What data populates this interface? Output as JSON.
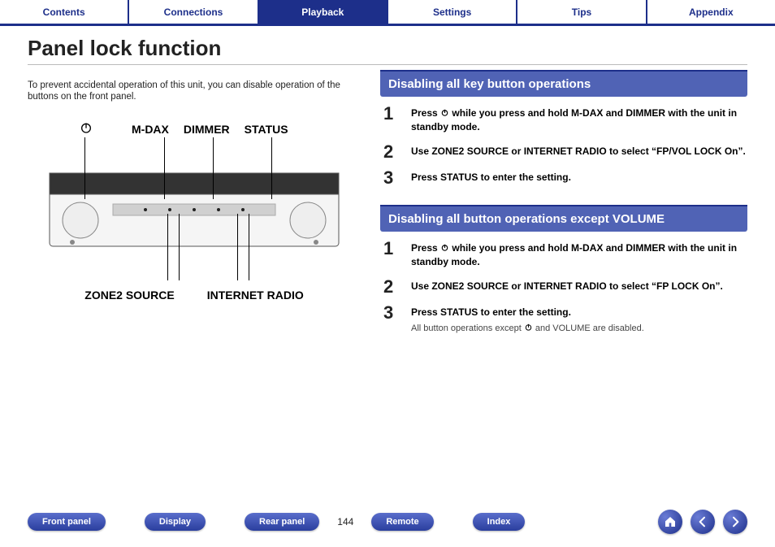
{
  "top_tabs": {
    "contents": "Contents",
    "connections": "Connections",
    "playback": "Playback",
    "settings": "Settings",
    "tips": "Tips",
    "appendix": "Appendix"
  },
  "active_tab": "playback",
  "page_title": "Panel lock function",
  "intro": "To prevent accidental operation of this unit, you can disable operation of the buttons on the front panel.",
  "diagram": {
    "labels_top": {
      "mdax": "M-DAX",
      "dimmer": "DIMMER",
      "status": "STATUS"
    },
    "labels_bottom": {
      "zone2_source": "ZONE2 SOURCE",
      "internet_radio": "INTERNET RADIO"
    }
  },
  "sections": [
    {
      "title": "Disabling all key button operations",
      "steps": [
        {
          "text_before": "Press ",
          "has_power_icon": true,
          "text_after": " while you press and hold M-DAX and DIMMER with the unit in standby mode."
        },
        {
          "text": "Use ZONE2 SOURCE or INTERNET RADIO to select “FP/VOL LOCK On”."
        },
        {
          "text": "Press STATUS to enter the setting."
        }
      ]
    },
    {
      "title": "Disabling all button operations except VOLUME",
      "steps": [
        {
          "text_before": "Press ",
          "has_power_icon": true,
          "text_after": " while you press and hold M-DAX and DIMMER with the unit in standby mode."
        },
        {
          "text": "Use ZONE2 SOURCE or INTERNET RADIO to select “FP LOCK On”."
        },
        {
          "text": "Press STATUS to enter the setting.",
          "note_before": "All button operations except ",
          "note_has_power_icon": true,
          "note_after": " and VOLUME are disabled."
        }
      ]
    }
  ],
  "page_number": "144",
  "bottom_nav": {
    "front_panel": "Front panel",
    "display": "Display",
    "rear_panel": "Rear panel",
    "remote": "Remote",
    "index": "Index"
  },
  "icons": {
    "home": "home-icon",
    "back": "arrow-left-icon",
    "forward": "arrow-right-icon",
    "power": "power-icon"
  }
}
